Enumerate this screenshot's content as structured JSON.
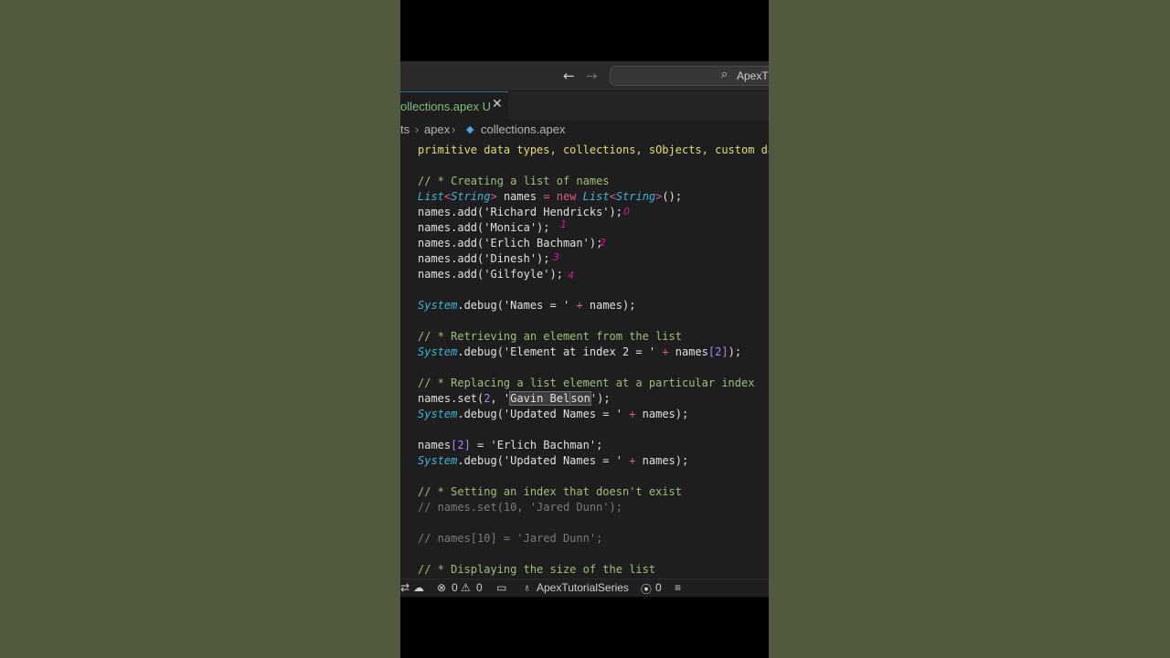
{
  "titlebar": {
    "back_icon": "←",
    "forward_icon": "→",
    "search_icon": "⌕",
    "command_center_text": "ApexTu"
  },
  "tab": {
    "label": "ollections.apex U",
    "close_icon": "✕"
  },
  "breadcrumb": {
    "part1": "ts",
    "sep": "›",
    "part2": "apex",
    "file_icon": "◆",
    "file": "collections.apex"
  },
  "code": {
    "l0": "primitive data types, collections, sObjects, custom data",
    "l1": "// * Creating a list of names",
    "l2_type1": "List",
    "l2_lt1": "<",
    "l2_type2": "String",
    "l2_gt1": ">",
    "l2_mid": " names ",
    "l2_eq": "=",
    "l2_new": " new ",
    "l2_type3": "List",
    "l2_lt2": "<",
    "l2_type4": "String",
    "l2_gt2": ">",
    "l2_end": "();",
    "l3": "names.add('Richard Hendricks');",
    "l4": "names.add('Monica');",
    "l5": "names.add('Erlich Bachman');",
    "l6": "names.add('Dinesh');",
    "l7": "names.add('Gilfoyle');",
    "l8_sys": "System",
    "l8_mid": ".debug('Names = ' ",
    "l8_plus": "+",
    "l8_end": " names);",
    "l9": "// * Retrieving an element from the list",
    "l10_sys": "System",
    "l10_mid": ".debug('Element at index 2 = ' ",
    "l10_plus": "+",
    "l10_names": " names",
    "l10_br": "[2]",
    "l10_end": ");",
    "l11": "// * Replacing a list element at a particular index",
    "l12_a": "names.set(",
    "l12_num": "2",
    "l12_b": ", '",
    "l12_sel1": "Gavin Bel",
    "l12_sel2": "son",
    "l12_c": "');",
    "l13_sys": "System",
    "l13_mid": ".debug('Updated Names = ' ",
    "l13_plus": "+",
    "l13_end": " names);",
    "l14_a": "names",
    "l14_br": "[2]",
    "l14_eq": " = ",
    "l14_b": "'Erlich Bachman';",
    "l15_sys": "System",
    "l15_mid": ".debug('Updated Names = ' ",
    "l15_plus": "+",
    "l15_end": " names);",
    "l16": "// * Setting an index that doesn't exist",
    "l17": "// names.set(10, 'Jared Dunn');",
    "l18": "// names[10] = 'Jared Dunn';",
    "l19": "// * Displaying the size of the list"
  },
  "annotations": {
    "a0": "0",
    "a1": "1",
    "a2": "2",
    "a3": "3",
    "a4": "4"
  },
  "statusbar": {
    "remote_icon": "⇄",
    "sync_icon": "☁",
    "errors_icon": "⊗",
    "errors": "0",
    "warnings_icon": "⚠",
    "warnings": "0",
    "panel_icon": "▭",
    "org_icon": "♁",
    "org": "ApexTutorialSeries",
    "ports_icon": "⦿",
    "ports": "0",
    "menu_icon": "≡"
  }
}
